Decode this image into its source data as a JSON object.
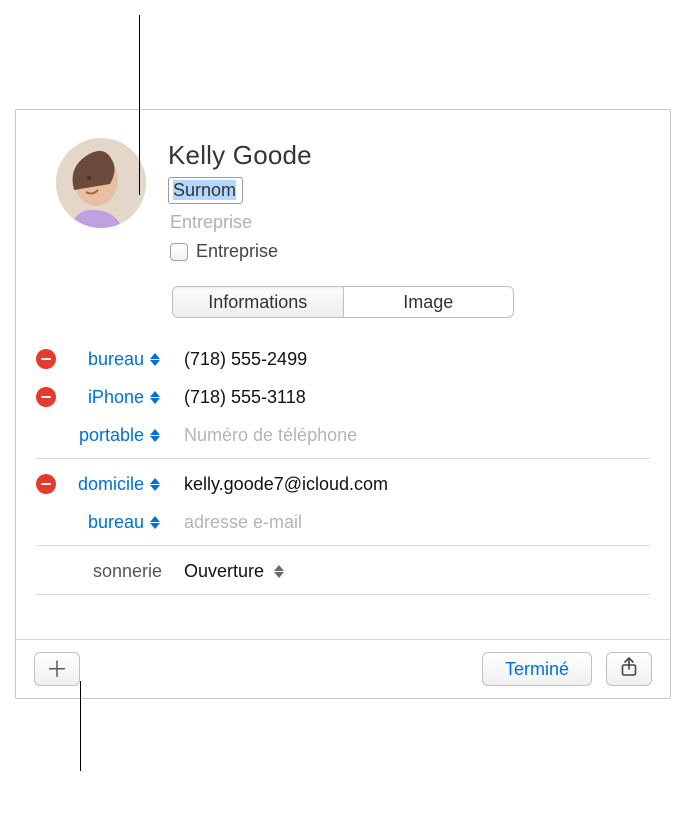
{
  "header": {
    "name": "Kelly  Goode",
    "nickname_placeholder": "Surnom",
    "company_placeholder": "Entreprise",
    "company_checkbox_label": "Entreprise"
  },
  "tabs": {
    "info": "Informations",
    "image": "Image"
  },
  "phones": [
    {
      "label": "bureau",
      "value": "(718) 555-2499",
      "deletable": true
    },
    {
      "label": "iPhone",
      "value": "(718) 555-3118",
      "deletable": true
    },
    {
      "label": "portable",
      "placeholder": "Numéro de téléphone",
      "deletable": false
    }
  ],
  "emails": [
    {
      "label": "domicile",
      "value": "kelly.goode7@icloud.com",
      "deletable": true
    },
    {
      "label": "bureau",
      "placeholder": "adresse e-mail",
      "deletable": false
    }
  ],
  "ringtone": {
    "label": "sonnerie",
    "value": "Ouverture"
  },
  "footer": {
    "done": "Terminé"
  }
}
